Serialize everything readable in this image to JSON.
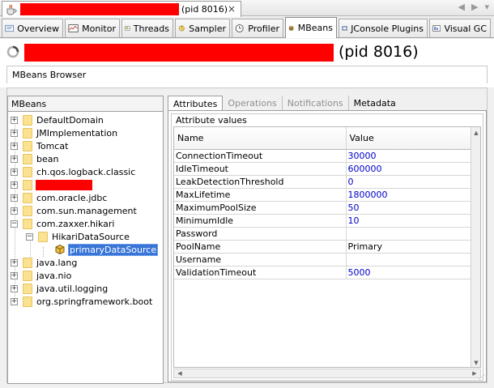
{
  "document_tab": {
    "pid_text": "(pid 8016)",
    "close_glyph": "×"
  },
  "nav": {
    "prev": "◀",
    "next": "▶",
    "menu": "▾"
  },
  "tool_tabs": [
    {
      "label": "Overview",
      "icon": "overview-icon"
    },
    {
      "label": "Monitor",
      "icon": "monitor-icon"
    },
    {
      "label": "Threads",
      "icon": "threads-icon"
    },
    {
      "label": "Sampler",
      "icon": "sampler-icon"
    },
    {
      "label": "Profiler",
      "icon": "profiler-icon"
    },
    {
      "label": "MBeans",
      "icon": "mbeans-icon",
      "active": true
    },
    {
      "label": "JConsole Plugins",
      "icon": "jconsole-icon"
    },
    {
      "label": "Visual GC",
      "icon": "visualgc-icon"
    }
  ],
  "header": {
    "pid_text": "(pid 8016)",
    "browser_label": "MBeans Browser"
  },
  "tree": {
    "title": "MBeans",
    "items": [
      {
        "label": "DefaultDomain"
      },
      {
        "label": "JMImplementation"
      },
      {
        "label": "Tomcat"
      },
      {
        "label": "bean"
      },
      {
        "label": "ch.qos.logback.classic"
      },
      {
        "label": ""
      },
      {
        "label": "com.oracle.jdbc"
      },
      {
        "label": "com.sun.management"
      },
      {
        "label": "com.zaxxer.hikari"
      },
      {
        "label": "HikariDataSource"
      },
      {
        "label": "primaryDataSource"
      },
      {
        "label": "java.lang"
      },
      {
        "label": "java.nio"
      },
      {
        "label": "java.util.logging"
      },
      {
        "label": "org.springframework.boot"
      }
    ],
    "expand_glyph": "+",
    "collapse_glyph": "−"
  },
  "right_tabs": {
    "attributes": "Attributes",
    "operations": "Operations",
    "notifications": "Notifications",
    "metadata": "Metadata"
  },
  "attributes": {
    "group_title": "Attribute values",
    "columns": {
      "name": "Name",
      "value": "Value"
    },
    "rows": [
      {
        "name": "ConnectionTimeout",
        "value": "30000",
        "numeric": true
      },
      {
        "name": "IdleTimeout",
        "value": "600000",
        "numeric": true
      },
      {
        "name": "LeakDetectionThreshold",
        "value": "0",
        "numeric": true
      },
      {
        "name": "MaxLifetime",
        "value": "1800000",
        "numeric": true
      },
      {
        "name": "MaximumPoolSize",
        "value": "50",
        "numeric": true
      },
      {
        "name": "MinimumIdle",
        "value": "10",
        "numeric": true
      },
      {
        "name": "Password",
        "value": "",
        "numeric": false
      },
      {
        "name": "PoolName",
        "value": "Primary",
        "numeric": false
      },
      {
        "name": "Username",
        "value": "",
        "numeric": false
      },
      {
        "name": "ValidationTimeout",
        "value": "5000",
        "numeric": true
      }
    ]
  },
  "colors": {
    "redaction": "#ff0000",
    "selection": "#3875d7",
    "numeric_value": "#0000c8"
  }
}
